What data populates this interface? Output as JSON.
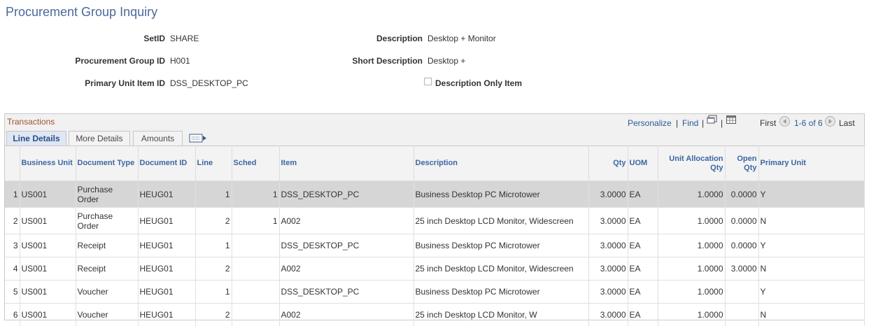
{
  "page": {
    "title": "Procurement Group Inquiry"
  },
  "header": {
    "setid_label": "SetID",
    "setid": "SHARE",
    "group_label": "Procurement Group ID",
    "group": "H001",
    "primary_label": "Primary Unit Item ID",
    "primary": "DSS_DESKTOP_PC",
    "desc_label": "Description",
    "desc": "Desktop + Monitor",
    "short_label": "Short Description",
    "short": "Desktop +",
    "desc_only_label": "Description Only Item"
  },
  "grid": {
    "title": "Transactions",
    "personalize": "Personalize",
    "find": "Find",
    "first": "First",
    "range": "1-6 of 6",
    "last": "Last",
    "tabs": [
      "Line Details",
      "More Details",
      "Amounts"
    ],
    "columns": [
      "",
      "Business Unit",
      "Document Type",
      "Document ID",
      "Line",
      "Sched",
      "Item",
      "Description",
      "Qty",
      "UOM",
      "Unit Allocation Qty",
      "Open Qty",
      "Primary Unit"
    ],
    "rows": [
      {
        "n": "1",
        "bu": "US001",
        "type": "Purchase Order",
        "doc": "HEUG01",
        "line": "1",
        "sched": "1",
        "item": "DSS_DESKTOP_PC",
        "desc": "Business Desktop PC Microtower",
        "qty": "3.0000",
        "uom": "EA",
        "alloc": "1.0000",
        "open": "0.0000",
        "primary": "Y"
      },
      {
        "n": "2",
        "bu": "US001",
        "type": "Purchase Order",
        "doc": "HEUG01",
        "line": "2",
        "sched": "1",
        "item": "A002",
        "desc": "25 inch Desktop LCD Monitor, Widescreen",
        "qty": "3.0000",
        "uom": "EA",
        "alloc": "1.0000",
        "open": "0.0000",
        "primary": "N"
      },
      {
        "n": "3",
        "bu": "US001",
        "type": "Receipt",
        "doc": "HEUG01",
        "line": "1",
        "sched": "",
        "item": "DSS_DESKTOP_PC",
        "desc": "Business Desktop PC Microtower",
        "qty": "3.0000",
        "uom": "EA",
        "alloc": "1.0000",
        "open": "0.0000",
        "primary": "Y"
      },
      {
        "n": "4",
        "bu": "US001",
        "type": "Receipt",
        "doc": "HEUG01",
        "line": "2",
        "sched": "",
        "item": "A002",
        "desc": "25 inch Desktop LCD Monitor, Widescreen",
        "qty": "3.0000",
        "uom": "EA",
        "alloc": "1.0000",
        "open": "3.0000",
        "primary": "N"
      },
      {
        "n": "5",
        "bu": "US001",
        "type": "Voucher",
        "doc": "HEUG01",
        "line": "1",
        "sched": "",
        "item": "DSS_DESKTOP_PC",
        "desc": "Business Desktop PC Microtower",
        "qty": "3.0000",
        "uom": "EA",
        "alloc": "1.0000",
        "open": "",
        "primary": "Y"
      },
      {
        "n": "6",
        "bu": "US001",
        "type": "Voucher",
        "doc": "HEUG01",
        "line": "2",
        "sched": "",
        "item": "A002",
        "desc": "25 inch Desktop LCD Monitor, W",
        "qty": "3.0000",
        "uom": "EA",
        "alloc": "1.0000",
        "open": "",
        "primary": "N"
      }
    ]
  },
  "icons": {
    "zoom": "view-all-icon",
    "download": "download-spreadsheet-icon",
    "prev": "previous-arrow-icon",
    "next": "next-arrow-icon",
    "tabs": "show-all-columns-icon"
  }
}
